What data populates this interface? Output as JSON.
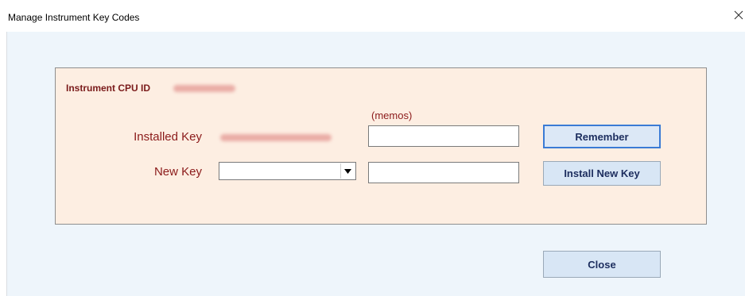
{
  "window": {
    "title": "Manage Instrument Key Codes"
  },
  "panel": {
    "cpu_id_label": "Instrument CPU ID",
    "memos_label": "(memos)",
    "installed_key": {
      "label": "Installed Key",
      "memo_value": ""
    },
    "new_key": {
      "label": "New Key",
      "selected_value": "",
      "memo_value": ""
    }
  },
  "buttons": {
    "remember": "Remember",
    "install_new_key": "Install New Key",
    "close": "Close"
  },
  "icons": {
    "window_close": "close-icon",
    "dropdown": "chevron-down-icon"
  },
  "colors": {
    "panel_background": "#fdeee2",
    "client_background": "#eef5fb",
    "label_text": "#8b1a1a",
    "button_background": "#d8e6f5",
    "button_text": "#1c2d5e",
    "focus_border": "#3a7bd5"
  }
}
